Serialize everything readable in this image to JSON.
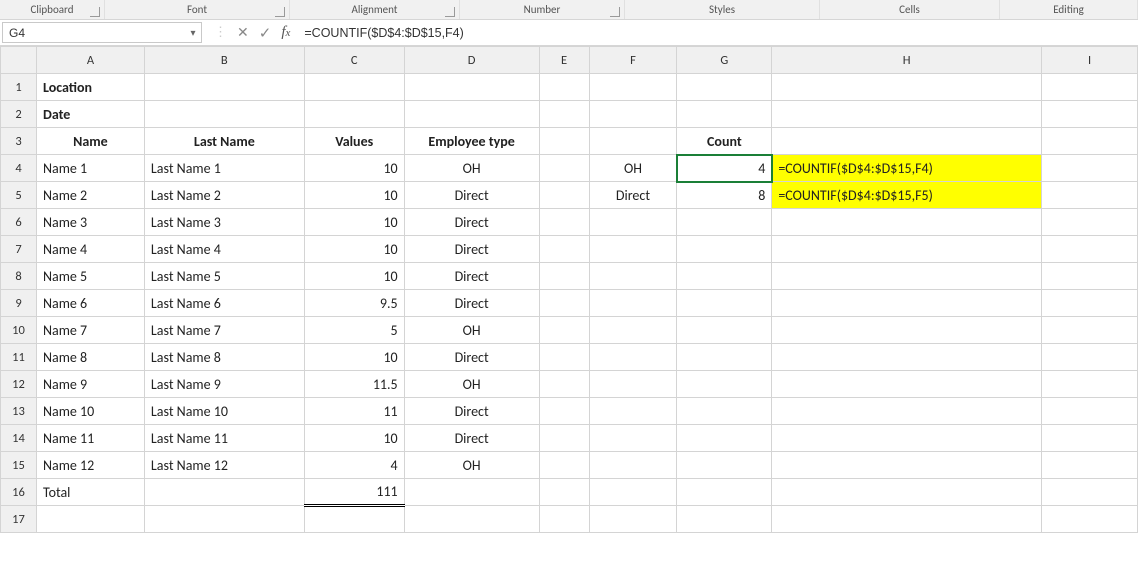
{
  "ribbon": {
    "groups": {
      "clipboard": "Clipboard",
      "font": "Font",
      "alignment": "Alignment",
      "number": "Number",
      "styles": "Styles",
      "cells": "Cells",
      "editing": "Editing"
    }
  },
  "formula_bar": {
    "name_box": "G4",
    "formula": "=COUNTIF($D$4:$D$15,F4)"
  },
  "columns": [
    "A",
    "B",
    "C",
    "D",
    "E",
    "F",
    "G",
    "H",
    "I"
  ],
  "row_numbers": [
    "1",
    "2",
    "3",
    "4",
    "5",
    "6",
    "7",
    "8",
    "9",
    "10",
    "11",
    "12",
    "13",
    "14",
    "15",
    "16",
    "17"
  ],
  "headers": {
    "a1": "Location",
    "a2": "Date",
    "r3": {
      "A": "Name",
      "B": "Last Name",
      "C": "Values",
      "D": "Employee type",
      "G": "Count"
    }
  },
  "rows": [
    {
      "A": "Name 1",
      "B": "Last Name 1",
      "C": "10",
      "D": "OH",
      "F": "OH",
      "G": "4",
      "H": "=COUNTIF($D$4:$D$15,F4)"
    },
    {
      "A": "Name 2",
      "B": "Last Name 2",
      "C": "10",
      "D": "Direct",
      "F": "Direct",
      "G": "8",
      "H": "=COUNTIF($D$4:$D$15,F5)"
    },
    {
      "A": "Name 3",
      "B": "Last Name 3",
      "C": "10",
      "D": "Direct"
    },
    {
      "A": "Name 4",
      "B": "Last Name 4",
      "C": "10",
      "D": "Direct"
    },
    {
      "A": "Name 5",
      "B": "Last Name 5",
      "C": "10",
      "D": "Direct"
    },
    {
      "A": "Name 6",
      "B": "Last Name 6",
      "C": "9.5",
      "D": "Direct"
    },
    {
      "A": "Name 7",
      "B": "Last Name 7",
      "C": "5",
      "D": "OH"
    },
    {
      "A": "Name 8",
      "B": "Last Name 8",
      "C": "10",
      "D": "Direct"
    },
    {
      "A": "Name 9",
      "B": "Last Name 9",
      "C": "11.5",
      "D": "OH"
    },
    {
      "A": "Name 10",
      "B": "Last Name 10",
      "C": "11",
      "D": "Direct"
    },
    {
      "A": "Name 11",
      "B": "Last Name 11",
      "C": "10",
      "D": "Direct"
    },
    {
      "A": "Name 12",
      "B": "Last Name 12",
      "C": "4",
      "D": "OH"
    }
  ],
  "total": {
    "label": "Total",
    "value": "111"
  }
}
